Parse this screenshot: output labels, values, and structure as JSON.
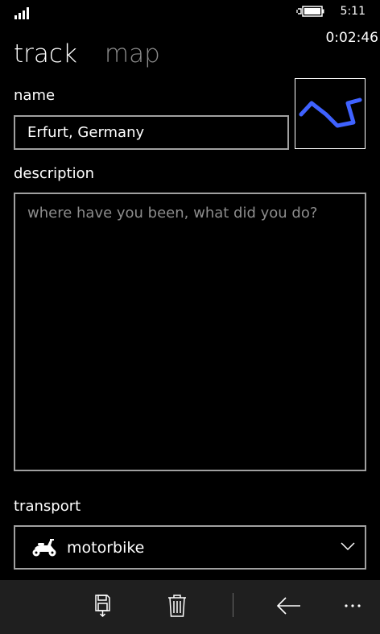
{
  "status_bar": {
    "clock": "5:11",
    "signal_icon": "signal-strength-icon",
    "battery_icon": "battery-charging-icon"
  },
  "timer": "0:02:46",
  "pivot": {
    "tabs": [
      {
        "label": "track",
        "active": true
      },
      {
        "label": "map",
        "active": false
      }
    ]
  },
  "form": {
    "name_label": "name",
    "name_value": "Erfurt, Germany",
    "description_label": "description",
    "description_placeholder": "where have you been, what did you do?",
    "transport_label": "transport",
    "transport_value": "motorbike",
    "transport_icon": "motorbike-icon",
    "track_color": "#3f62ff"
  },
  "app_bar": {
    "buttons": [
      {
        "icon": "save-icon"
      },
      {
        "icon": "delete-icon"
      },
      {
        "icon": "back-arrow-icon"
      },
      {
        "icon": "more-icon"
      }
    ]
  }
}
